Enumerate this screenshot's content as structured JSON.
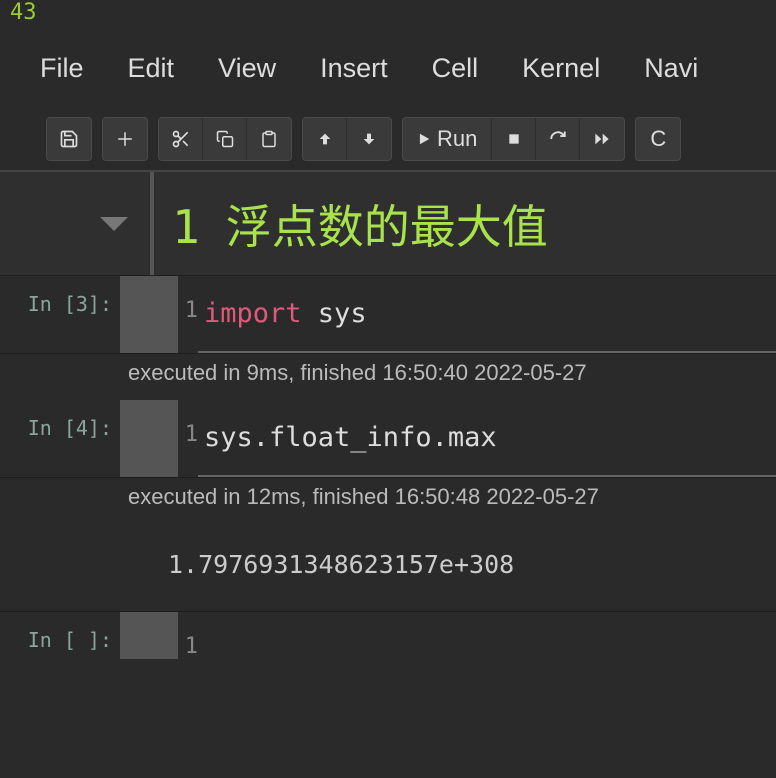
{
  "topnum": "43",
  "menubar": [
    "File",
    "Edit",
    "View",
    "Insert",
    "Cell",
    "Kernel",
    "Navi"
  ],
  "toolbar": {
    "run_label": "Run",
    "code_label": "C"
  },
  "heading": {
    "index": "1",
    "title": "浮点数的最大值"
  },
  "cells": [
    {
      "prompt": "In [3]:",
      "line_no": "1",
      "code_prefix_kw": "import",
      "code_rest": " sys",
      "exec_info": "executed in 9ms, finished 16:50:40 2022-05-27"
    },
    {
      "prompt": "In [4]:",
      "line_no": "1",
      "code_plain": "sys.float_info.max",
      "exec_info": "executed in 12ms, finished 16:50:48 2022-05-27",
      "output": "1.7976931348623157e+308"
    },
    {
      "prompt": "In [ ]:",
      "line_no": "1",
      "code_plain": ""
    }
  ]
}
